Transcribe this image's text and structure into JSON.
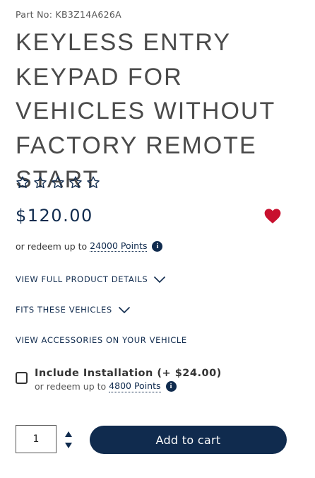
{
  "product": {
    "part_no": "Part No: KB3Z14A626A",
    "title": "KEYLESS ENTRY KEYPAD FOR VEHICLES WITHOUT FACTORY REMOTE START",
    "rating": {
      "filled": 0,
      "max": 5
    },
    "price": "$120.00",
    "redeem_prefix": "or redeem up to",
    "redeem_points": "24000 Points"
  },
  "links": {
    "details": "VIEW FULL PRODUCT DETAILS",
    "fits": "FITS THESE VEHICLES",
    "accessories": "VIEW ACCESSORIES ON YOUR VEHICLE"
  },
  "installation": {
    "label": "Include Installation (+ $24.00)",
    "redeem_prefix": "or redeem up to",
    "redeem_points": "4800 Points",
    "checked": false
  },
  "cart": {
    "quantity": "1",
    "add_label": "Add to cart"
  },
  "icons": {
    "info": "i",
    "wishlist": "heart-icon",
    "star": "star-outline-icon",
    "expand": "chevron-down-icon",
    "stepper": "up-down-arrows-icon"
  },
  "colors": {
    "brand": "#102b4e",
    "heart": "#c8102e",
    "title": "#4a4a4a"
  }
}
